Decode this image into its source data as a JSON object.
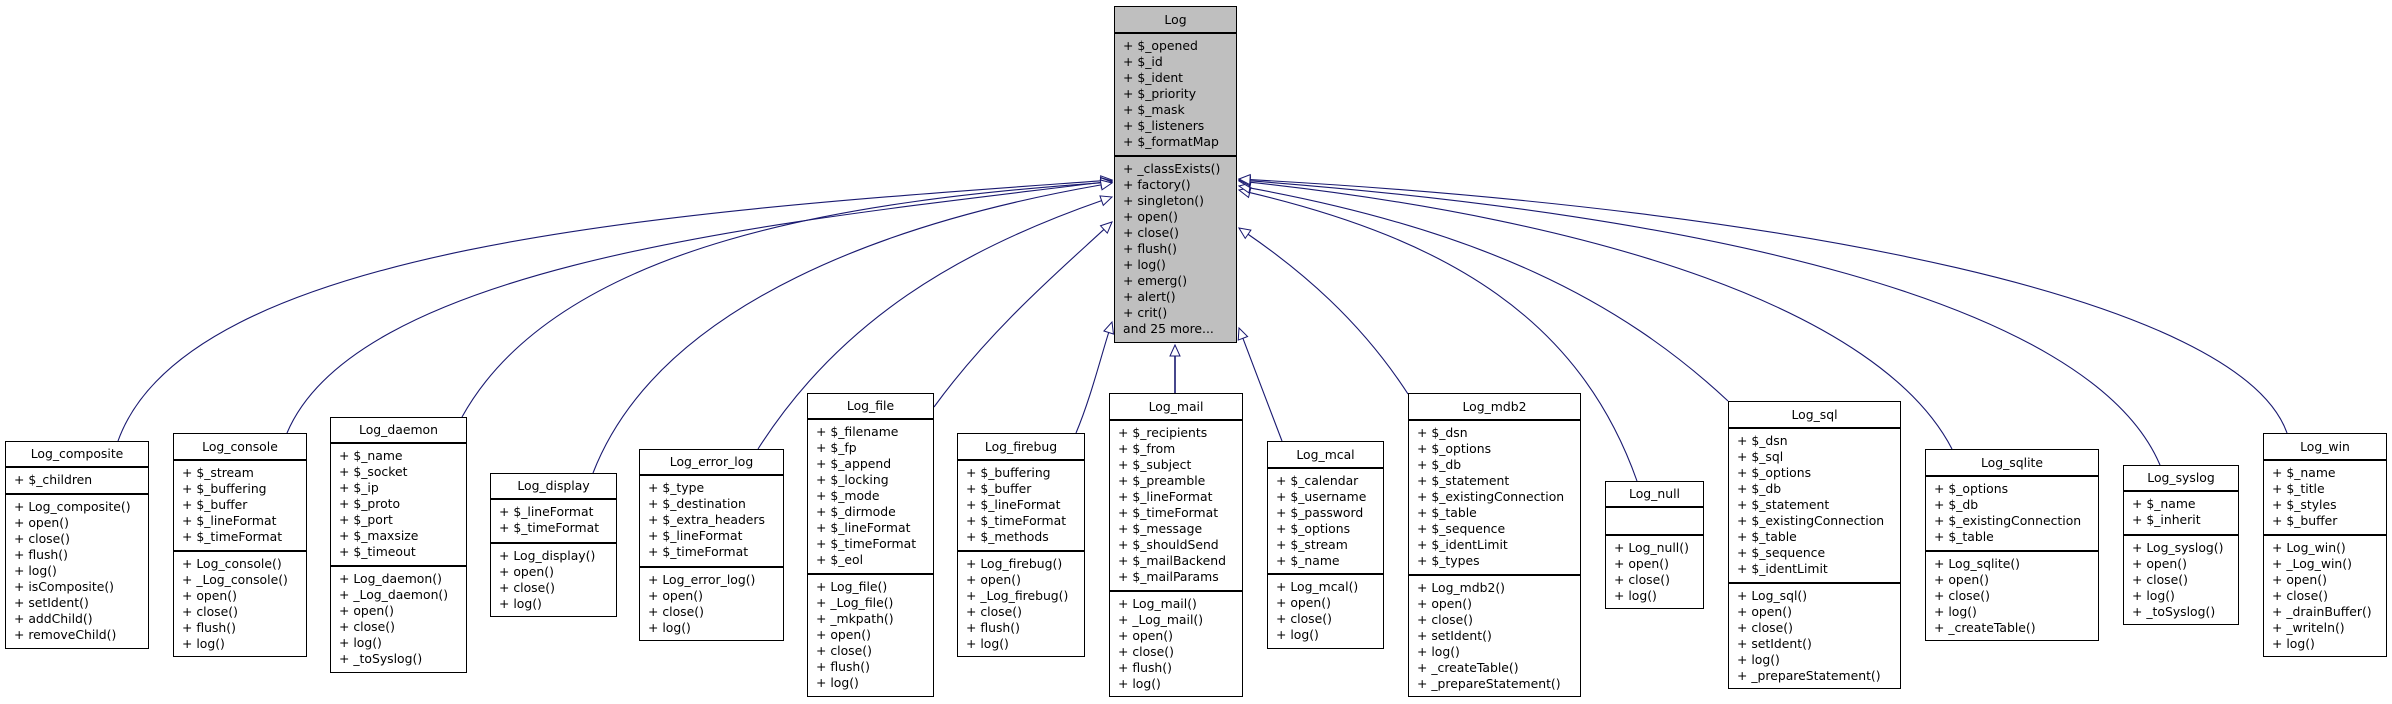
{
  "diagram": {
    "type": "class-inheritance",
    "edge_color": "#191970",
    "root_fill": "#bfbfbf",
    "root": {
      "name": "Log",
      "attributes": [
        "+ $_opened",
        "+ $_id",
        "+ $_ident",
        "+ $_priority",
        "+ $_mask",
        "+ $_listeners",
        "+ $_formatMap"
      ],
      "methods": [
        "+ _classExists()",
        "+ factory()",
        "+ singleton()",
        "+ open()",
        "+ close()",
        "+ flush()",
        "+ log()",
        "+ emerg()",
        "+ alert()",
        "+ crit()",
        "and 25 more..."
      ]
    },
    "subclasses": [
      {
        "name": "Log_composite",
        "attributes": [
          "+ $_children"
        ],
        "methods": [
          "+ Log_composite()",
          "+ open()",
          "+ close()",
          "+ flush()",
          "+ log()",
          "+ isComposite()",
          "+ setIdent()",
          "+ addChild()",
          "+ removeChild()"
        ]
      },
      {
        "name": "Log_console",
        "attributes": [
          "+ $_stream",
          "+ $_buffering",
          "+ $_buffer",
          "+ $_lineFormat",
          "+ $_timeFormat"
        ],
        "methods": [
          "+ Log_console()",
          "+ _Log_console()",
          "+ open()",
          "+ close()",
          "+ flush()",
          "+ log()"
        ]
      },
      {
        "name": "Log_daemon",
        "attributes": [
          "+ $_name",
          "+ $_socket",
          "+ $_ip",
          "+ $_proto",
          "+ $_port",
          "+ $_maxsize",
          "+ $_timeout"
        ],
        "methods": [
          "+ Log_daemon()",
          "+ _Log_daemon()",
          "+ open()",
          "+ close()",
          "+ log()",
          "+ _toSyslog()"
        ]
      },
      {
        "name": "Log_display",
        "attributes": [
          "+ $_lineFormat",
          "+ $_timeFormat"
        ],
        "methods": [
          "+ Log_display()",
          "+ open()",
          "+ close()",
          "+ log()"
        ]
      },
      {
        "name": "Log_error_log",
        "attributes": [
          "+ $_type",
          "+ $_destination",
          "+ $_extra_headers",
          "+ $_lineFormat",
          "+ $_timeFormat"
        ],
        "methods": [
          "+ Log_error_log()",
          "+ open()",
          "+ close()",
          "+ log()"
        ]
      },
      {
        "name": "Log_file",
        "attributes": [
          "+ $_filename",
          "+ $_fp",
          "+ $_append",
          "+ $_locking",
          "+ $_mode",
          "+ $_dirmode",
          "+ $_lineFormat",
          "+ $_timeFormat",
          "+ $_eol"
        ],
        "methods": [
          "+ Log_file()",
          "+ _Log_file()",
          "+ _mkpath()",
          "+ open()",
          "+ close()",
          "+ flush()",
          "+ log()"
        ]
      },
      {
        "name": "Log_firebug",
        "attributes": [
          "+ $_buffering",
          "+ $_buffer",
          "+ $_lineFormat",
          "+ $_timeFormat",
          "+ $_methods"
        ],
        "methods": [
          "+ Log_firebug()",
          "+ open()",
          "+ _Log_firebug()",
          "+ close()",
          "+ flush()",
          "+ log()"
        ]
      },
      {
        "name": "Log_mail",
        "attributes": [
          "+ $_recipients",
          "+ $_from",
          "+ $_subject",
          "+ $_preamble",
          "+ $_lineFormat",
          "+ $_timeFormat",
          "+ $_message",
          "+ $_shouldSend",
          "+ $_mailBackend",
          "+ $_mailParams"
        ],
        "methods": [
          "+ Log_mail()",
          "+ _Log_mail()",
          "+ open()",
          "+ close()",
          "+ flush()",
          "+ log()"
        ]
      },
      {
        "name": "Log_mcal",
        "attributes": [
          "+ $_calendar",
          "+ $_username",
          "+ $_password",
          "+ $_options",
          "+ $_stream",
          "+ $_name"
        ],
        "methods": [
          "+ Log_mcal()",
          "+ open()",
          "+ close()",
          "+ log()"
        ]
      },
      {
        "name": "Log_mdb2",
        "attributes": [
          "+ $_dsn",
          "+ $_options",
          "+ $_db",
          "+ $_statement",
          "+ $_existingConnection",
          "+ $_table",
          "+ $_sequence",
          "+ $_identLimit",
          "+ $_types"
        ],
        "methods": [
          "+ Log_mdb2()",
          "+ open()",
          "+ close()",
          "+ setIdent()",
          "+ log()",
          "+ _createTable()",
          "+ _prepareStatement()"
        ]
      },
      {
        "name": "Log_null",
        "attributes": [],
        "methods": [
          "+ Log_null()",
          "+ open()",
          "+ close()",
          "+ log()"
        ]
      },
      {
        "name": "Log_sql",
        "attributes": [
          "+ $_dsn",
          "+ $_sql",
          "+ $_options",
          "+ $_db",
          "+ $_statement",
          "+ $_existingConnection",
          "+ $_table",
          "+ $_sequence",
          "+ $_identLimit"
        ],
        "methods": [
          "+ Log_sql()",
          "+ open()",
          "+ close()",
          "+ setIdent()",
          "+ log()",
          "+ _prepareStatement()"
        ]
      },
      {
        "name": "Log_sqlite",
        "attributes": [
          "+ $_options",
          "+ $_db",
          "+ $_existingConnection",
          "+ $_table"
        ],
        "methods": [
          "+ Log_sqlite()",
          "+ open()",
          "+ close()",
          "+ log()",
          "+ _createTable()"
        ]
      },
      {
        "name": "Log_syslog",
        "attributes": [
          "+ $_name",
          "+ $_inherit"
        ],
        "methods": [
          "+ Log_syslog()",
          "+ open()",
          "+ close()",
          "+ log()",
          "+ _toSyslog()"
        ]
      },
      {
        "name": "Log_win",
        "attributes": [
          "+ $_name",
          "+ $_title",
          "+ $_styles",
          "+ $_buffer"
        ],
        "methods": [
          "+ Log_win()",
          "+ _Log_win()",
          "+ open()",
          "+ close()",
          "+ _drainBuffer()",
          "+ _writeln()",
          "+ log()"
        ]
      }
    ]
  }
}
